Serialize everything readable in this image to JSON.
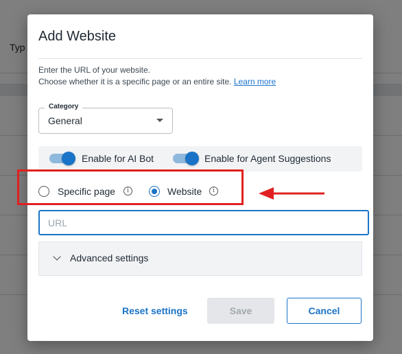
{
  "background": {
    "column_header": "Typ"
  },
  "dialog": {
    "title": "Add Website",
    "description_line1": "Enter the URL of your website.",
    "description_line2": "Choose whether it is a specific page or an entire site.",
    "learn_more": "Learn more",
    "category": {
      "label": "Category",
      "value": "General"
    },
    "toggles": [
      {
        "label": "Enable for AI Bot",
        "on": true
      },
      {
        "label": "Enable for Agent Suggestions",
        "on": true
      }
    ],
    "radios": [
      {
        "label": "Specific page",
        "selected": false
      },
      {
        "label": "Website",
        "selected": true
      }
    ],
    "url": {
      "placeholder": "URL",
      "value": ""
    },
    "advanced": {
      "label": "Advanced settings"
    },
    "buttons": {
      "reset": "Reset settings",
      "save": "Save",
      "cancel": "Cancel"
    }
  },
  "colors": {
    "accent": "#1a73c7",
    "annotation": "#e02020"
  },
  "icons": [
    "chevron-down-icon",
    "info-icon",
    "arrow-left-icon"
  ]
}
